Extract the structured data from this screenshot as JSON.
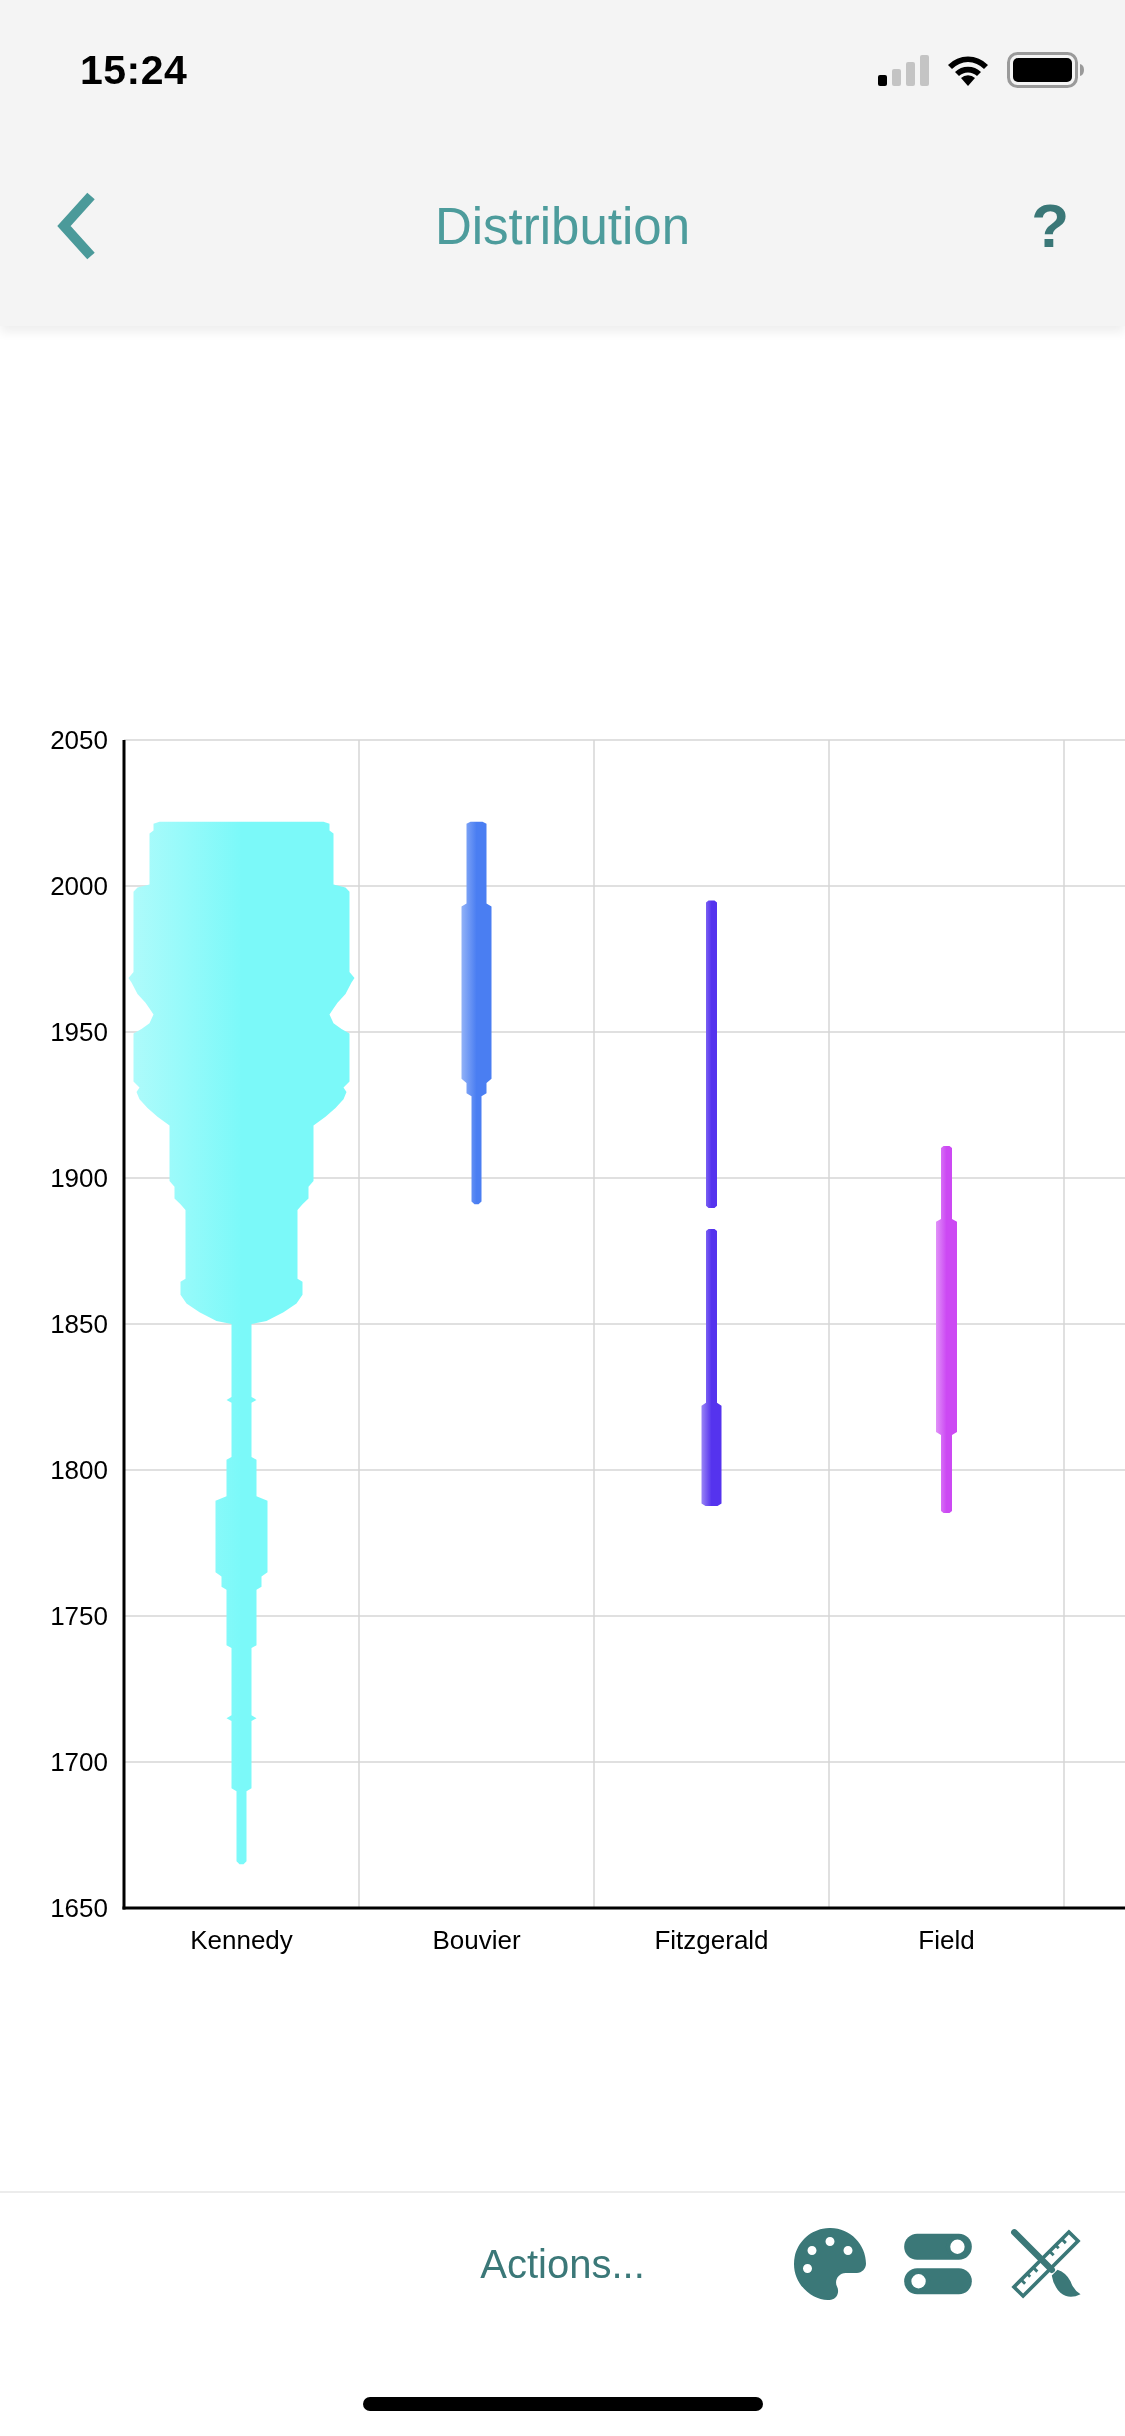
{
  "status_bar": {
    "time": "15:24"
  },
  "nav_bar": {
    "title": "Distribution",
    "help": "?"
  },
  "chart": {
    "y_ticks": [
      "2050",
      "2000",
      "1950",
      "1900",
      "1850",
      "1800",
      "1750",
      "1700",
      "1650"
    ],
    "categories": [
      {
        "label": "Kennedy",
        "color": "#7bf9f9"
      },
      {
        "label": "Bouvier",
        "color": "#4a7ef2"
      },
      {
        "label": "Fitzgerald",
        "color": "#5533ee"
      },
      {
        "label": "Field",
        "color": "#cc49f3"
      }
    ]
  },
  "toolbar": {
    "actions": "Actions..."
  }
}
